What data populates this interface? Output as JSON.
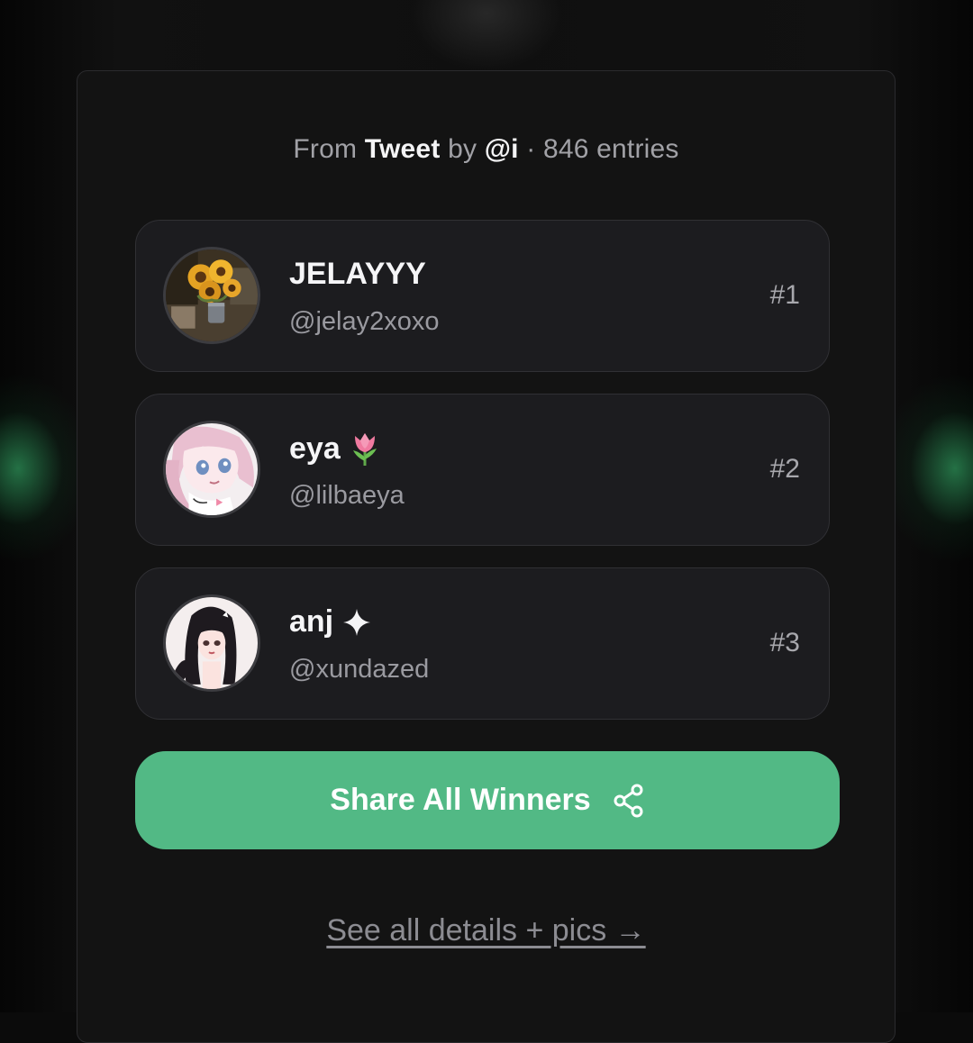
{
  "header": {
    "prefix": "From",
    "source": "Tweet",
    "by": "by",
    "author": "@i",
    "entries": "· 846 entries"
  },
  "winners": [
    {
      "name": "JELAYYY",
      "handle": "@jelay2xoxo",
      "rank": "#1",
      "avatar": "sunflower-photo"
    },
    {
      "name": "eya",
      "name_emoji": "tulip",
      "handle": "@lilbaeya",
      "rank": "#2",
      "avatar": "anime-girl-pink-hair"
    },
    {
      "name": "anj",
      "name_emoji": "sparkle",
      "handle": "@xundazed",
      "rank": "#3",
      "avatar": "anime-girl-dark-hair"
    }
  ],
  "actions": {
    "share_label": "Share All Winners",
    "details_label": "See all details + pics →"
  },
  "colors": {
    "accent": "#52b985",
    "card_bg": "#1c1c1f",
    "page_bg": "#131313"
  }
}
